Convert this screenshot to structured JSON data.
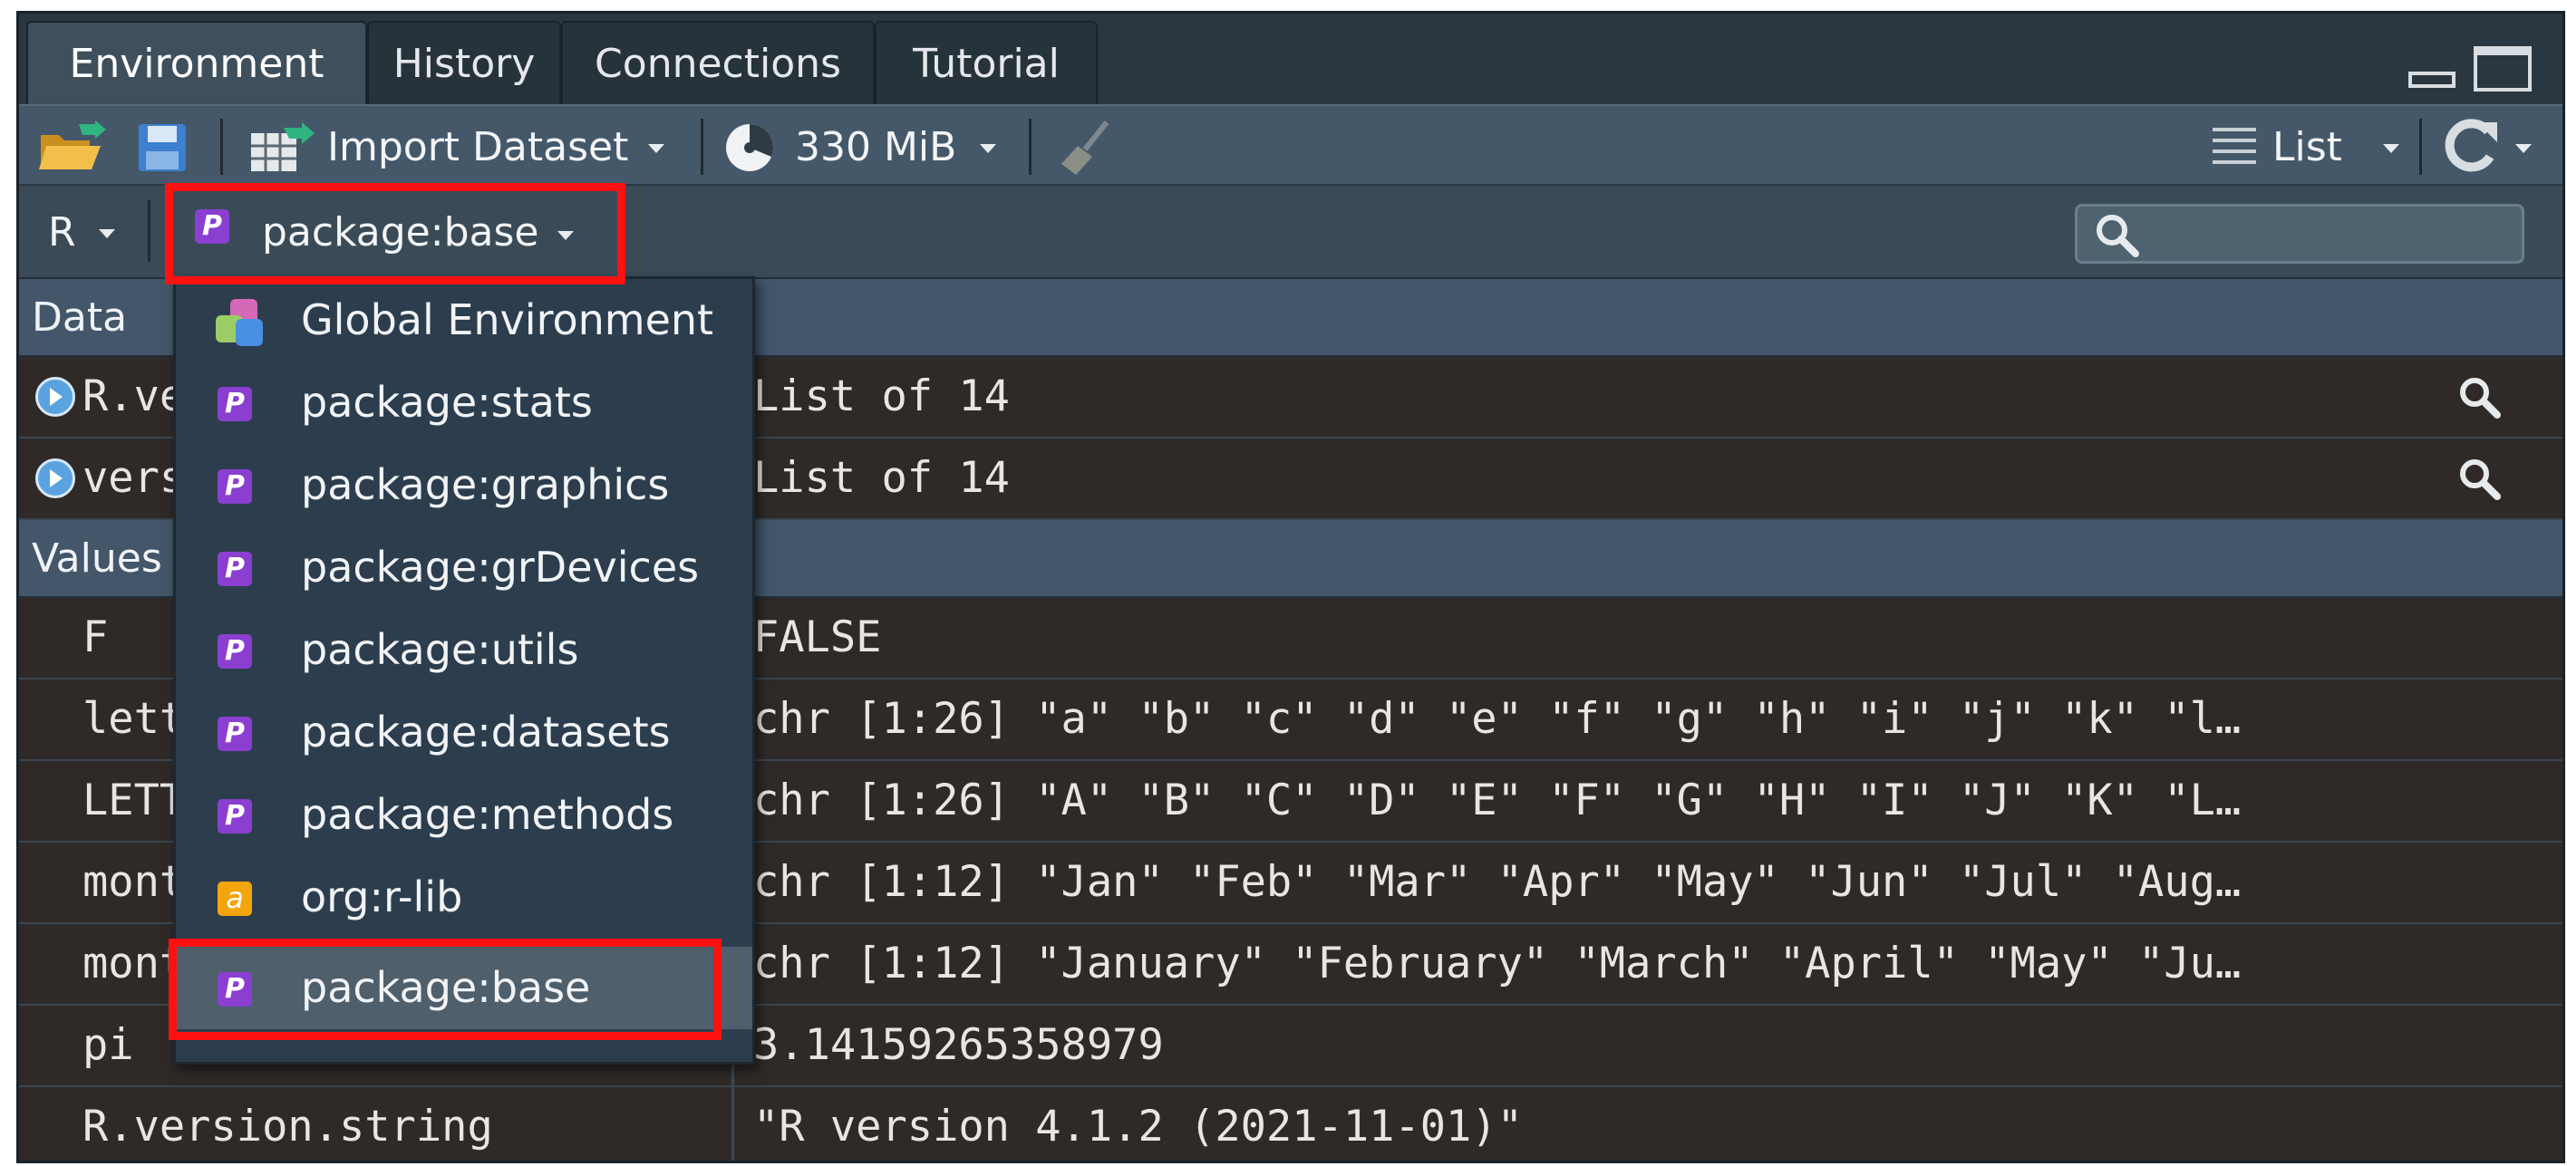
{
  "tabs": [
    {
      "label": "Environment",
      "active": true
    },
    {
      "label": "History",
      "active": false
    },
    {
      "label": "Connections",
      "active": false
    },
    {
      "label": "Tutorial",
      "active": false
    }
  ],
  "toolbar": {
    "import_label": "Import Dataset",
    "memory_label": "330 MiB",
    "view_label": "List"
  },
  "toolbar2": {
    "language": "R",
    "env_selector": "package:base",
    "search_placeholder": ""
  },
  "sections": [
    {
      "label": "Data"
    },
    {
      "label": "Values"
    }
  ],
  "data_rows": [
    {
      "name": "R.version",
      "value": "List of  14"
    },
    {
      "name": "version",
      "value": "List of  14"
    }
  ],
  "value_rows": [
    {
      "name": "F",
      "value": "FALSE"
    },
    {
      "name": "letters",
      "value": "chr [1:26] \"a\" \"b\" \"c\" \"d\" \"e\" \"f\" \"g\" \"h\" \"i\" \"j\" \"k\" \"l…"
    },
    {
      "name": "LETTERS",
      "value": "chr [1:26] \"A\" \"B\" \"C\" \"D\" \"E\" \"F\" \"G\" \"H\" \"I\" \"J\" \"K\" \"L…"
    },
    {
      "name": "month.abb",
      "value": "chr [1:12] \"Jan\" \"Feb\" \"Mar\" \"Apr\" \"May\" \"Jun\" \"Jul\" \"Aug…"
    },
    {
      "name": "month.name",
      "value": "chr [1:12] \"January\" \"February\" \"March\" \"April\" \"May\" \"Ju…"
    },
    {
      "name": "pi",
      "value": "3.14159265358979"
    },
    {
      "name": "R.version.string",
      "value": "\"R version 4.1.2 (2021-11-01)\""
    }
  ],
  "dropdown": {
    "items": [
      {
        "label": "Global Environment",
        "icon": "global-env-icon"
      },
      {
        "label": "package:stats",
        "icon": "package-icon"
      },
      {
        "label": "package:graphics",
        "icon": "package-icon"
      },
      {
        "label": "package:grDevices",
        "icon": "package-icon"
      },
      {
        "label": "package:utils",
        "icon": "package-icon"
      },
      {
        "label": "package:datasets",
        "icon": "package-icon"
      },
      {
        "label": "package:methods",
        "icon": "package-icon"
      },
      {
        "label": "org:r-lib",
        "icon": "attached-env-icon"
      },
      {
        "label": "package:base",
        "icon": "package-icon",
        "selected": true
      }
    ],
    "package_glyph": "P",
    "attached_glyph": "a"
  },
  "colors": {
    "highlight": "#ff1111",
    "package_icon": "#8a3fd1",
    "attached_icon": "#f2a50c"
  }
}
